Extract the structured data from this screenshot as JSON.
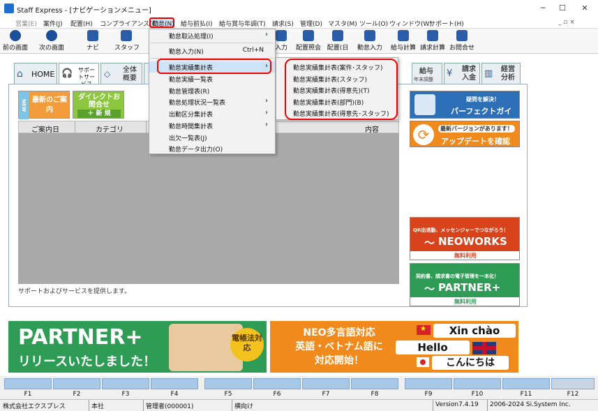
{
  "window": {
    "title": "Staff Express - [ナビゲーションメニュー]",
    "minimize": "─",
    "maximize": "☐",
    "close": "✕"
  },
  "menubar": {
    "items": [
      "営業(E)",
      "案件(J)",
      "配置(H)",
      "コンプライアンス(C)",
      "勤怠(N)",
      "給与前払(I)",
      "給与賞与年調(T)",
      "請求(S)",
      "管理(D)",
      "マスタ(M)",
      "ツール(O)",
      "ウィンドウ(W)",
      "サポート(H)"
    ]
  },
  "toolbar": {
    "buttons": [
      "前の画面",
      "次の画面",
      "ナビ",
      "スタッフ",
      "入力",
      "配置照会",
      "配置(日",
      "勤怠入力",
      "給与計算",
      "請求計算",
      "お問合せ"
    ]
  },
  "navtabs": {
    "home": "HOME",
    "support": "サポートサービス",
    "overview": "全体概要",
    "payroll": "給与",
    "payroll_sub": "年末調整",
    "billing": "請求入金",
    "management": "経営分析"
  },
  "tiles": {
    "new_badge": "NEW",
    "news": "最新のご案内",
    "direct": "ダイレクトお問合せ",
    "new_btn": "＋ 新 規"
  },
  "grid": {
    "headers": [
      "ご案内日",
      "カテゴリ",
      "内容"
    ]
  },
  "footnote": "サポートおよびサービスを提供します。",
  "side_banners": {
    "guide_sub": "疑問を解決！",
    "guide_title": "パーフェクトガイド",
    "update_sub": "最新バージョンがあります！",
    "update_title": "アップデートを確認",
    "neoworks_sub": "QR出退勤、メッセンジャーでつながろう！",
    "neoworks_title": "NEOWORKS",
    "neoworks_free": "無料利用",
    "partner_sub": "契約書、請求書の電子管理を一本化！",
    "partner_title": "PARTNER+",
    "partner_free": "無料利用"
  },
  "bottom_banners": {
    "left_title": "PARTNER+",
    "left_sub": "リリースいたしました！",
    "left_badge": "電帳法対応",
    "right_title1": "NEO多言語対応",
    "right_title2": "英語・ベトナム語に",
    "right_title3": "対応開始！",
    "xin_chao": "Xin chào",
    "hello": "Hello",
    "konnichiwa": "こんにちは"
  },
  "menu_attendance": {
    "items": [
      {
        "label": "勤怠取込処理(I)",
        "arrow": "›",
        "shortcut": ""
      },
      {
        "label": "勤怠入力(N)",
        "arrow": "",
        "shortcut": "Ctrl+N"
      },
      {
        "label": "勤怠実績集計表",
        "arrow": "›",
        "shortcut": ""
      },
      {
        "label": "勤怠実績一覧表",
        "arrow": "",
        "shortcut": ""
      },
      {
        "label": "勤怠管理表(R)",
        "arrow": "",
        "shortcut": ""
      },
      {
        "label": "勤怠処理状況一覧表",
        "arrow": "›",
        "shortcut": ""
      },
      {
        "label": "出勤区分集計表",
        "arrow": "›",
        "shortcut": ""
      },
      {
        "label": "勤怠時間集計表",
        "arrow": "›",
        "shortcut": ""
      },
      {
        "label": "出欠一覧表(J)",
        "arrow": "",
        "shortcut": ""
      },
      {
        "label": "勤怠データ出力(O)",
        "arrow": "",
        "shortcut": ""
      }
    ]
  },
  "submenu": {
    "items": [
      "勤怠実績集計表(案件･スタッフ)",
      "勤怠実績集計表(スタッフ)",
      "勤怠実績集計表(得意先)(T)",
      "勤怠実績集計表(部門)(B)",
      "勤怠実績集計表(得意先･スタッフ)"
    ]
  },
  "fkeys": [
    "F1",
    "F2",
    "F3",
    "F4",
    "F5",
    "F6",
    "F7",
    "F8",
    "F9",
    "F10",
    "F11",
    "F12"
  ],
  "status": {
    "company": "株式会社エクスプレス",
    "branch": "本社",
    "user": "管理者(000001)",
    "mode": "横向け",
    "version": "Version7.4.19",
    "copyright": "2006-2024 Si.System Inc."
  }
}
